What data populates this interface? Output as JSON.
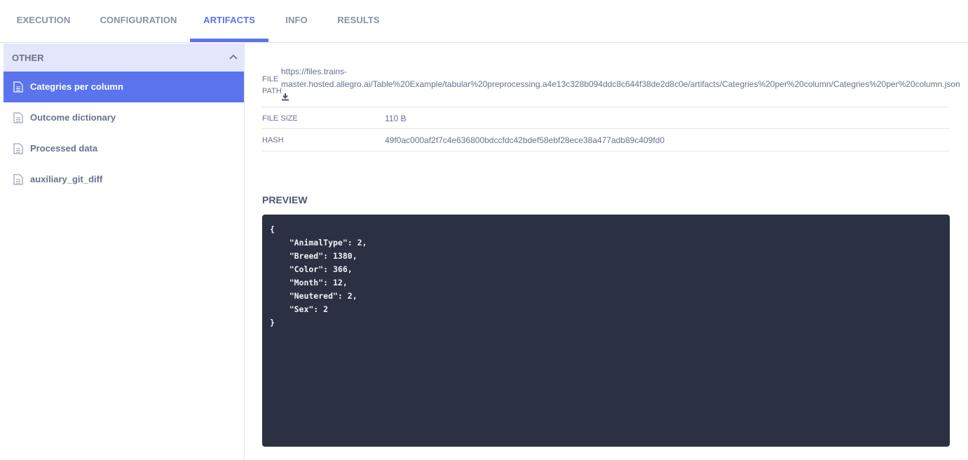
{
  "tabs": [
    {
      "label": "EXECUTION"
    },
    {
      "label": "CONFIGURATION"
    },
    {
      "label": "ARTIFACTS"
    },
    {
      "label": "INFO"
    },
    {
      "label": "RESULTS"
    }
  ],
  "active_tab": "ARTIFACTS",
  "sidebar": {
    "section_title": "OTHER",
    "items": [
      {
        "label": "Categries per column",
        "icon": "document-icon",
        "active": true
      },
      {
        "label": "Outcome dictionary",
        "icon": "document-icon",
        "active": false
      },
      {
        "label": "Processed data",
        "icon": "document-icon",
        "active": false
      },
      {
        "label": "auxiliary_git_diff",
        "icon": "document-icon",
        "active": false
      }
    ]
  },
  "details": {
    "file_path_label_1": "FILE",
    "file_path_label_2": "PATH",
    "file_path_line1": "https://files.trains-",
    "file_path_line2": "master.hosted.allegro.ai/Table%20Example/tabular%20preprocessing.a4e13c328b094ddc8c644f38de2d8c0e/artifacts/Categries%20per%20column/Categries%20per%20column.json",
    "file_size_label": "FILE SIZE",
    "file_size_value": "110 B",
    "hash_label": "HASH",
    "hash_value": "49f0ac000af2f7c4e636800bdccfdc42bdef58ebf28ece38a477adb89c409fd0"
  },
  "preview": {
    "title": "PREVIEW",
    "content": "{\n    \"AnimalType\": 2,\n    \"Breed\": 1380,\n    \"Color\": 366,\n    \"Month\": 12,\n    \"Neutered\": 2,\n    \"Sex\": 2\n}"
  },
  "colors": {
    "accent": "#5a74ee",
    "sidebar_header_bg": "#e4e7fb",
    "code_bg": "#2b3042"
  }
}
